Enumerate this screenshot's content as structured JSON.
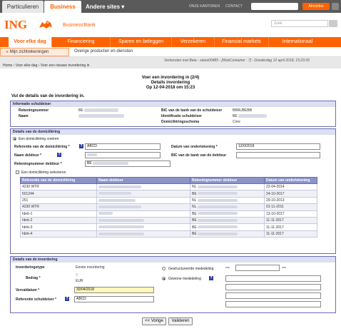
{
  "topbar": {
    "tab_particulieren": "Particulieren",
    "tab_business": "Business",
    "tab_andere": "Andere sites",
    "link_kantoren": "ONZE KANTOREN",
    "link_contact": "CONTACT",
    "logout_label": "Afmelden"
  },
  "header": {
    "logo_text": "ING",
    "business_bank": "Business'Bank",
    "search_placeholder": "Zoek"
  },
  "nav": {
    "items": [
      "Voor elke dag",
      "Financiering",
      "Sparen en beleggen",
      "Verzekeren",
      "Financial markets",
      "Internationaal"
    ],
    "active": "Voor elke dag"
  },
  "subnav": {
    "item1": "Mijn zichtrekeningen",
    "item2": "Overige producten en diensten"
  },
  "status_line": "Verbonden met Beta - sbeia00485 - [WebContainer : 7] - Donderdag 12 april 2018, 15:23:39",
  "breadcrumb": "Home  ›  Voor elke dag  ›  Voer een nieuwe invordering in",
  "titles": {
    "line1": "Voer een invordering in (2/4)",
    "line2": "Details invordering",
    "line3": "Op 12-04-2018 om 15:23"
  },
  "intro": "Vul de details van de invordering in.",
  "info_section": {
    "header": "Informatie schuldeiser",
    "rekeningnummer_label": "Rekeningnummer",
    "naam_label": "Naam",
    "bic_label": "BIC van de bank van de schuldeiser",
    "bic_value": "BBRUBEBB",
    "id_label": "Identificatie schuldeiser",
    "id_value": "BE",
    "schema_label": "Domiciliëringsschema",
    "schema_value": "Core",
    "rek_prefix": "BE"
  },
  "dom_section": {
    "header": "Details van de domiciliëring",
    "create_label": "Een domiciliëring creëren",
    "ref_label": "Referentie van de domiciliëring *",
    "ref_value": "ABCD",
    "date_label": "Datum van ondertekening *",
    "date_value": "12/0/2018",
    "naam_label": "Naam debiteur *",
    "bic_label": "BIC van de bank van de debiteur",
    "rek_label": "Rekeningnummer debiteur *",
    "rek_value": "BE",
    "select_label": "Een domiciliëring selecteren"
  },
  "table": {
    "headers": [
      "Referentie van de domiciliëring",
      "Naam debiteur",
      "Rekeningnummer debiteur",
      "Datum van ondertekening"
    ],
    "rows": [
      {
        "ref": "4230 WTR",
        "acc": "NL",
        "date": "22-04-2014"
      },
      {
        "ref": "501244",
        "acc": "BE",
        "date": "24-10-2017"
      },
      {
        "ref": "251",
        "acc": "NL",
        "date": "29-10-2013"
      },
      {
        "ref": "4230 WTR",
        "acc": "NL",
        "date": "01-11-2011"
      },
      {
        "ref": "hbrb-1",
        "acc": "BE",
        "date": "13-10-2017"
      },
      {
        "ref": "hbrb-2",
        "acc": "BE",
        "date": "11-11-2017"
      },
      {
        "ref": "hbrb-3",
        "acc": "BE",
        "date": "11-11-2017"
      },
      {
        "ref": "hbrb-4",
        "acc": "BE",
        "date": "11-11-2017"
      }
    ]
  },
  "inv_section": {
    "header": "Details van de invordering",
    "type_label": "Invorderingstype",
    "type_value": "Eerste invordering",
    "bedrag_label": "Bedrag *",
    "bedrag_value": "0",
    "currency": "EUR",
    "verval_label": "Vervaldatum *",
    "verval_value": "30/04/2018",
    "ref_label": "Referentie schuldeiser *",
    "ref_value": "ABCD",
    "gestruct_label": "Gestructureerde mededeling",
    "stars_left": "***",
    "stars_right": "***",
    "gewone_label": "Gewone mededeling"
  },
  "buttons": {
    "back": "<< Vorige",
    "validate": "Valideren"
  }
}
